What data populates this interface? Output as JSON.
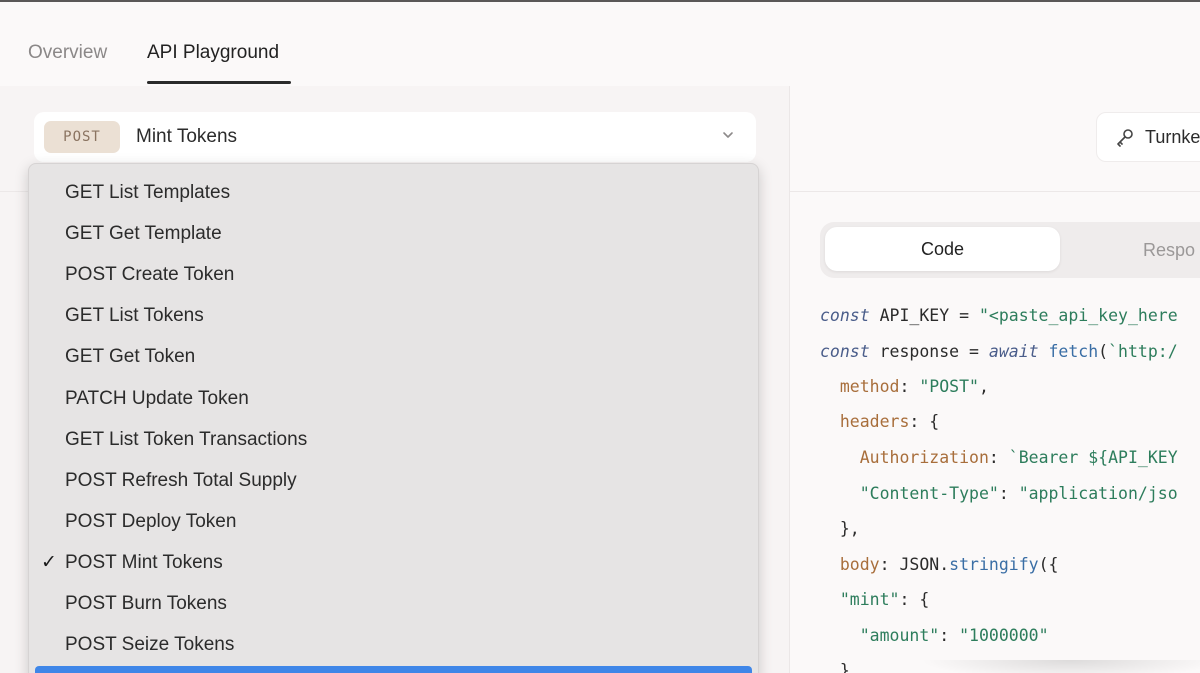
{
  "tabs": {
    "overview": "Overview",
    "playground": "API Playground"
  },
  "endpoint": {
    "method": "POST",
    "name": "Mint Tokens"
  },
  "dropdown": {
    "options": [
      "GET List Templates",
      "GET Get Template",
      "POST Create Token",
      "GET List Tokens",
      "GET Get Token",
      "PATCH Update Token",
      "GET List Token Transactions",
      "POST Refresh Total Supply",
      "POST Deploy Token",
      "POST Mint Tokens",
      "POST Burn Tokens",
      "POST Seize Tokens"
    ],
    "selected_index": 9,
    "check_glyph": "✓"
  },
  "auth": {
    "label": "Turnke"
  },
  "segment": {
    "code": "Code",
    "response": "Respo"
  },
  "code": {
    "l1_kw": "const",
    "l1_id": " API_KEY = ",
    "l1_str": "\"<paste_api_key_here",
    "l2_kw1": "const",
    "l2_id": " response = ",
    "l2_kw2": "await",
    "l2_fn": " fetch",
    "l2_pn": "(",
    "l2_str": "`http:/",
    "l3_prop": "  method",
    "l3_pn": ": ",
    "l3_str": "\"POST\"",
    "l3_end": ",",
    "l4_prop": "  headers",
    "l4_pn": ": {",
    "l5_prop": "    Authorization",
    "l5_pn": ": ",
    "l5_str": "`Bearer ${API_KEY",
    "l6_str1": "    \"Content-Type\"",
    "l6_pn": ": ",
    "l6_str2": "\"application/jso",
    "l7_pn": "  },",
    "l8_prop": "  body",
    "l8_pn": ": JSON.",
    "l8_fn": "stringify",
    "l8_end": "({",
    "l9_str": "  \"mint\"",
    "l9_pn": ": {",
    "l10_str1": "    \"amount\"",
    "l10_pn": ": ",
    "l10_str2": "\"1000000\"",
    "l11_pn": "  }"
  },
  "colors": {
    "highlight": "#3f86e8",
    "method_badge_bg": "#ebe0d4",
    "method_badge_fg": "#8a7360"
  },
  "icons": [
    "chevron-down-icon",
    "check-icon",
    "key-icon"
  ]
}
